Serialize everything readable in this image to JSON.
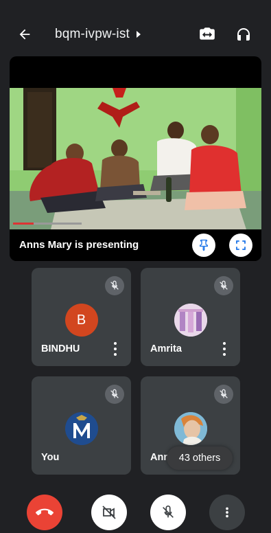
{
  "header": {
    "meeting_code": "bqm-ivpw-ist",
    "back_icon": "arrow-back-icon",
    "switch_camera_icon": "switch-camera-icon",
    "audio_icon": "headphones-icon"
  },
  "presentation": {
    "label": "Anns Mary is presenting",
    "pin_icon": "pin-icon",
    "fullscreen_icon": "fullscreen-icon"
  },
  "participants": [
    {
      "name": "BINDHU",
      "initial": "B",
      "avatar_color": "#d2461f",
      "muted": true,
      "has_menu": true
    },
    {
      "name": "Amrita",
      "initial": "",
      "avatar_color": "#c9a7c8",
      "muted": true,
      "has_menu": true
    },
    {
      "name": "You",
      "initial": "M",
      "avatar_color": "#1f4c8f",
      "muted": true,
      "has_menu": false
    },
    {
      "name": "Anns Mary",
      "initial": "",
      "avatar_color": "#6aa8c9",
      "muted": true,
      "has_menu": false
    }
  ],
  "others_count": "43 others",
  "controls": {
    "end_call_color": "#ea4335",
    "end_call_icon": "end-call-icon",
    "camera_icon": "camera-off-icon",
    "mic_icon": "mic-off-icon",
    "more_icon": "more-vert-icon"
  },
  "colors": {
    "background": "#202124",
    "tile": "#3c4043",
    "accent_blue": "#1a73e8",
    "end_call": "#ea4335"
  }
}
